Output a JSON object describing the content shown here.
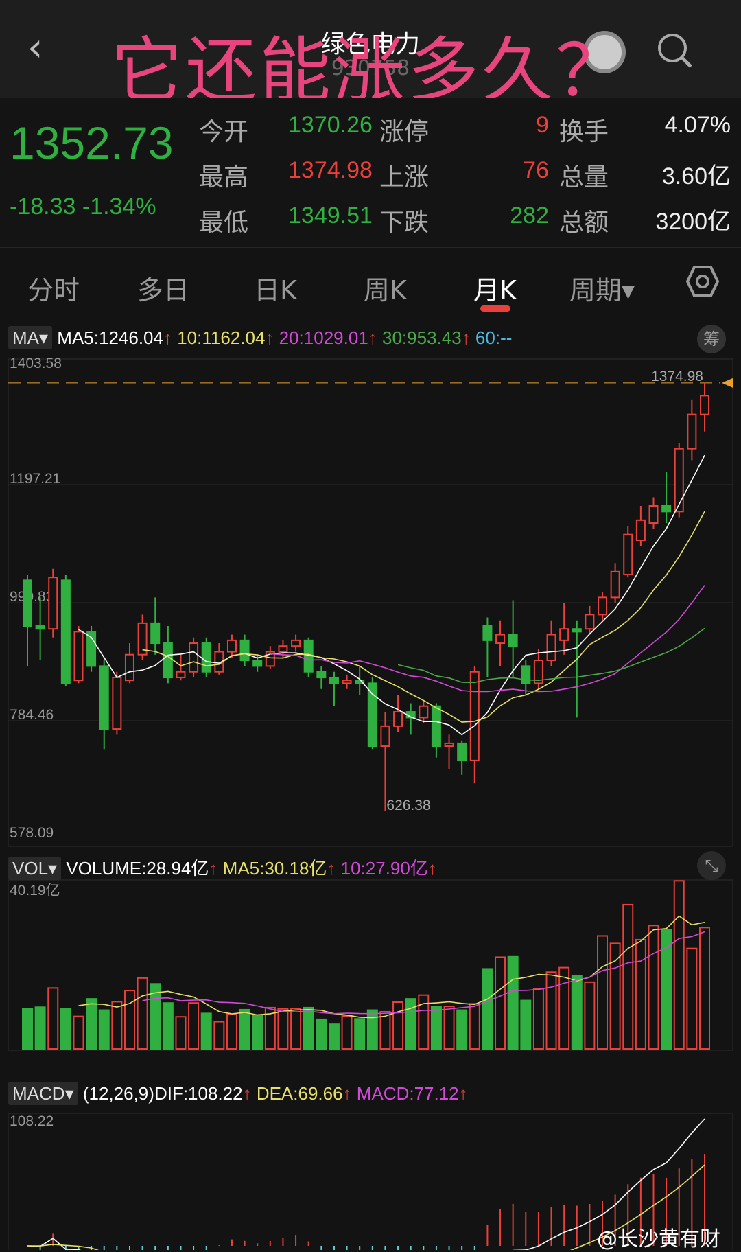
{
  "header": {
    "back": "‹",
    "title": "绿色电力",
    "code": "930758",
    "overlay": "它还能涨多久？"
  },
  "quote": {
    "price": "1352.73",
    "change": "-18.33",
    "change_pct": "-1.34%",
    "rows": [
      {
        "l1": "今开",
        "v1": "1370.26",
        "c1": "green",
        "l2": "涨停",
        "v2": "9",
        "c2": "red",
        "l3": "换手",
        "v3": "4.07%"
      },
      {
        "l1": "最高",
        "v1": "1374.98",
        "c1": "red",
        "l2": "上涨",
        "v2": "76",
        "c2": "red",
        "l3": "总量",
        "v3": "3.60亿"
      },
      {
        "l1": "最低",
        "v1": "1349.51",
        "c1": "green",
        "l2": "下跌",
        "v2": "282",
        "c2": "green",
        "l3": "总额",
        "v3": "3200亿"
      }
    ]
  },
  "tabs": [
    "分时",
    "多日",
    "日K",
    "周K",
    "月K",
    "周期▾"
  ],
  "active_tab": "月K",
  "ma_row": {
    "label": "MA",
    "ma5": "MA5:1246.04",
    "ma10": "10:1162.04",
    "ma20": "20:1029.01",
    "ma30": "30:953.43",
    "ma60": "60:--",
    "chip": "筹",
    "arrow": "↑"
  },
  "price_axis": [
    "1403.58",
    "1197.21",
    "990.83",
    "784.46",
    "578.09"
  ],
  "high_label": "1374.98",
  "low_label": "626.38",
  "vol_row": {
    "label": "VOL",
    "volume": "VOLUME:28.94亿",
    "ma5": "MA5:30.18亿",
    "ma10": "10:27.90亿",
    "top": "40.19亿"
  },
  "macd_row": {
    "label": "MACD",
    "params": "(12,26,9)",
    "dif": "DIF:108.22",
    "dea": "DEA:69.66",
    "macd": "MACD:77.12",
    "top": "108.22"
  },
  "watermark": "@长沙黄有财",
  "colors": {
    "up": "#e8403a",
    "down": "#2fb040",
    "ma5": "#ffffff",
    "ma10": "#e6e06a",
    "ma20": "#d04ad6",
    "ma30": "#4aa84a",
    "ma60": "#4ab8e0"
  },
  "chart_data": {
    "type": "candlestick",
    "price_range": [
      578.09,
      1403.58
    ],
    "volume_max": 40.19,
    "ohlc": [
      [
        1030,
        1040,
        880,
        950
      ],
      [
        950,
        1000,
        890,
        945
      ],
      [
        945,
        1050,
        930,
        1035
      ],
      [
        1030,
        1040,
        845,
        850
      ],
      [
        855,
        950,
        850,
        940
      ],
      [
        940,
        950,
        870,
        880
      ],
      [
        880,
        890,
        735,
        770
      ],
      [
        770,
        870,
        760,
        860
      ],
      [
        855,
        920,
        850,
        900
      ],
      [
        900,
        970,
        890,
        955
      ],
      [
        955,
        1000,
        900,
        920
      ],
      [
        920,
        950,
        850,
        860
      ],
      [
        860,
        900,
        855,
        870
      ],
      [
        870,
        930,
        860,
        920
      ],
      [
        920,
        930,
        860,
        870
      ],
      [
        870,
        920,
        865,
        905
      ],
      [
        905,
        935,
        895,
        925
      ],
      [
        925,
        935,
        880,
        890
      ],
      [
        890,
        900,
        870,
        880
      ],
      [
        880,
        915,
        875,
        905
      ],
      [
        905,
        925,
        895,
        915
      ],
      [
        915,
        935,
        905,
        925
      ],
      [
        925,
        930,
        860,
        870
      ],
      [
        870,
        880,
        840,
        860
      ],
      [
        860,
        870,
        810,
        850
      ],
      [
        850,
        865,
        840,
        855
      ],
      [
        855,
        880,
        830,
        850
      ],
      [
        850,
        860,
        735,
        740
      ],
      [
        740,
        800,
        626.38,
        775
      ],
      [
        775,
        830,
        765,
        800
      ],
      [
        800,
        815,
        760,
        790
      ],
      [
        790,
        820,
        780,
        810
      ],
      [
        810,
        815,
        720,
        740
      ],
      [
        740,
        760,
        700,
        745
      ],
      [
        745,
        750,
        690,
        715
      ],
      [
        715,
        880,
        675,
        870
      ],
      [
        950,
        965,
        860,
        925
      ],
      [
        920,
        960,
        880,
        935
      ],
      [
        935,
        995,
        860,
        915
      ],
      [
        880,
        890,
        830,
        850
      ],
      [
        850,
        910,
        840,
        890
      ],
      [
        890,
        960,
        880,
        935
      ],
      [
        925,
        990,
        900,
        945
      ],
      [
        945,
        960,
        790,
        940
      ],
      [
        945,
        985,
        935,
        970
      ],
      [
        970,
        1010,
        960,
        1000
      ],
      [
        1000,
        1060,
        990,
        1045
      ],
      [
        1040,
        1125,
        1035,
        1110
      ],
      [
        1100,
        1160,
        1090,
        1135
      ],
      [
        1130,
        1175,
        1120,
        1160
      ],
      [
        1160,
        1220,
        1130,
        1150
      ],
      [
        1150,
        1270,
        1140,
        1260
      ],
      [
        1260,
        1345,
        1240,
        1320
      ],
      [
        1320,
        1374.98,
        1290,
        1352.73
      ]
    ],
    "volume": [
      9.7,
      10,
      14.6,
      9.7,
      7.8,
      12,
      9.3,
      11.3,
      14,
      17,
      15.6,
      11,
      7.7,
      11,
      8.5,
      6.5,
      8.3,
      9.4,
      8,
      9.9,
      9.6,
      9.7,
      9.9,
      7.1,
      5.9,
      7.9,
      7.2,
      9.3,
      8.9,
      11.2,
      12,
      12.9,
      10.1,
      10.2,
      9.3,
      10.8,
      19.2,
      22,
      22.1,
      11.6,
      14.4,
      18.4,
      19.5,
      17.6,
      16,
      27.1,
      25.3,
      34.6,
      26.2,
      29.6,
      28.6,
      40.3,
      24.1,
      29.1
    ]
  }
}
